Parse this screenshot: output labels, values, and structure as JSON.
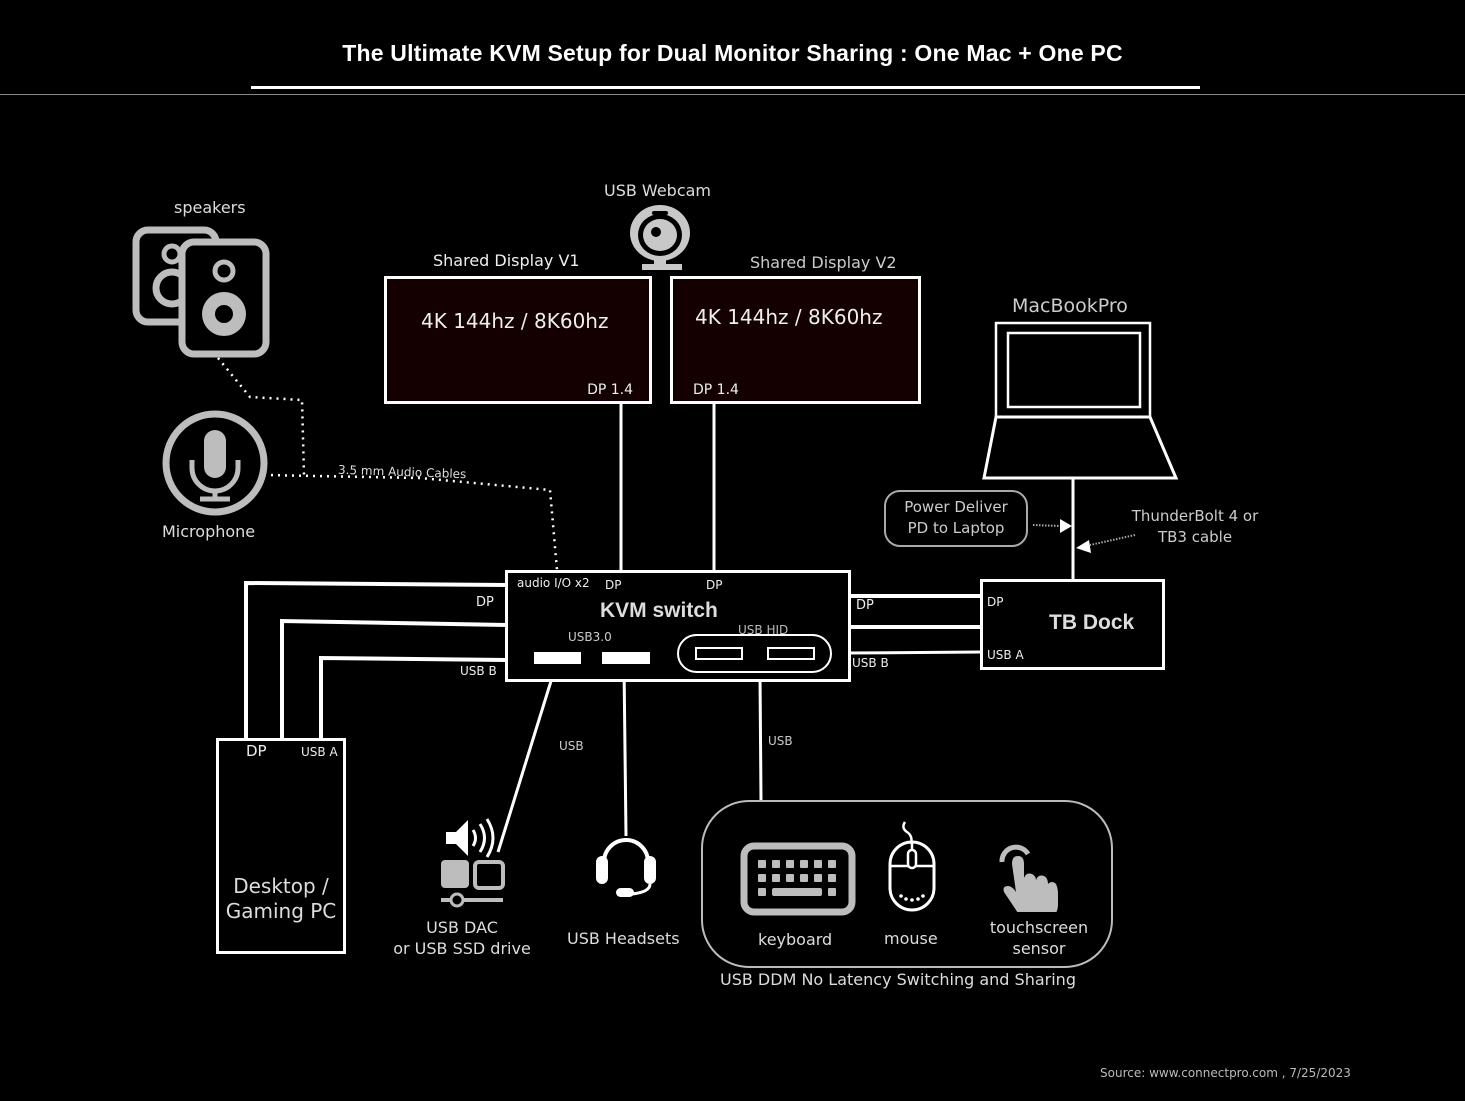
{
  "title": "The Ultimate KVM Setup for Dual Monitor Sharing  : One Mac + One PC",
  "source": "Source: www.connectpro.com , 7/25/2023",
  "colors": {
    "background": "#000000",
    "line": "#ffffff",
    "display_fill": "#140000",
    "icon_gray": "#bdbdbd"
  },
  "speakers": {
    "label": "speakers",
    "icon": "speaker-icon"
  },
  "microphone": {
    "label": "Microphone",
    "icon": "microphone-icon"
  },
  "audio_cable": {
    "label": "3.5 mm Audio Cables"
  },
  "webcam": {
    "label": "USB Webcam",
    "icon": "webcam-icon"
  },
  "display_v1": {
    "label": "Shared Display V1",
    "spec": "4K 144hz  / 8K60hz",
    "port": "DP 1.4"
  },
  "display_v2": {
    "label": "Shared Display V2",
    "spec": "4K 144hz  / 8K60hz",
    "port": "DP 1.4"
  },
  "macbook": {
    "label": "MacBookPro",
    "icon": "laptop-icon"
  },
  "power_delivery": {
    "line1": "Power Deliver",
    "line2": "PD to Laptop"
  },
  "thunderbolt": {
    "line1": "ThunderBolt 4 or",
    "line2": "TB3 cable"
  },
  "kvm": {
    "title": "KVM switch",
    "audio_port": "audio I/O x2",
    "dp_top_1": "DP",
    "dp_top_2": "DP",
    "usb3": "USB3.0",
    "usb_hid": "USB HID",
    "left_dp": "DP",
    "left_usb_b": "USB B",
    "right_dp": "DP",
    "right_usb_b": "USB B"
  },
  "tb_dock": {
    "title": "TB Dock",
    "dp": "DP",
    "usb_a": "USB A"
  },
  "pc": {
    "line1": "Desktop /",
    "line2": "Gaming PC",
    "dp": "DP",
    "usb_a": "USB A"
  },
  "usb_label_1": "USB",
  "usb_label_2": "USB",
  "usb_dac": {
    "line1": "USB DAC",
    "line2": "or USB SSD drive",
    "icon": "usb-dac-icon"
  },
  "headset": {
    "label": "USB Headsets",
    "icon": "headset-icon"
  },
  "hid_group": {
    "caption": "USB DDM No Latency Switching and Sharing",
    "keyboard": "keyboard",
    "mouse": "mouse",
    "touch_line1": "touchscreen",
    "touch_line2": "sensor"
  }
}
